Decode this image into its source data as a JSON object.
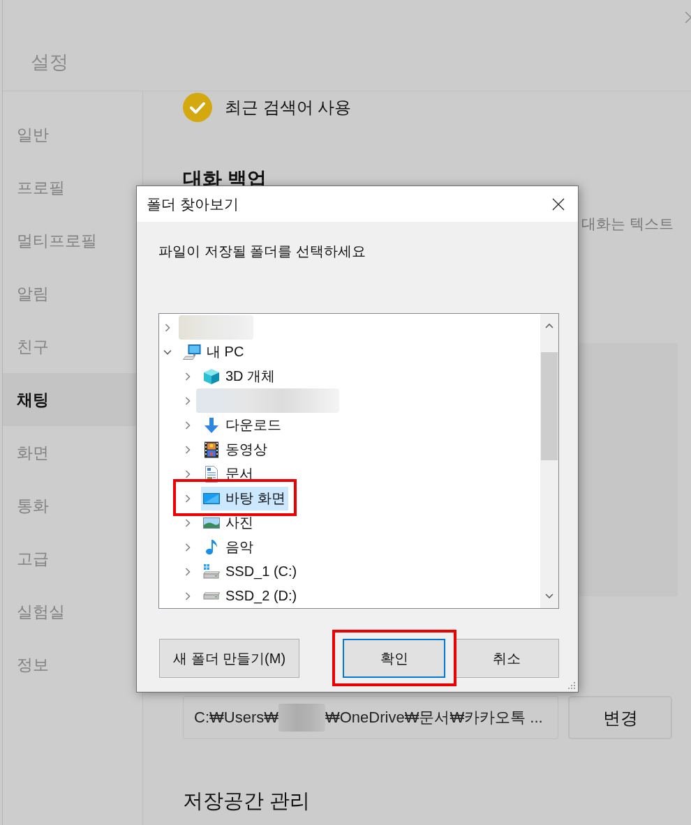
{
  "window": {
    "title": "설정"
  },
  "sidebar": {
    "items": [
      {
        "label": "일반",
        "selected": false
      },
      {
        "label": "프로필",
        "selected": false
      },
      {
        "label": "멀티프로필",
        "selected": false
      },
      {
        "label": "알림",
        "selected": false
      },
      {
        "label": "친구",
        "selected": false
      },
      {
        "label": "채팅",
        "selected": true
      },
      {
        "label": "화면",
        "selected": false
      },
      {
        "label": "통화",
        "selected": false
      },
      {
        "label": "고급",
        "selected": false
      },
      {
        "label": "실험실",
        "selected": false
      },
      {
        "label": "정보",
        "selected": false
      }
    ]
  },
  "content": {
    "recent_search": {
      "label": "최근 검색어 사용",
      "checked": true
    },
    "backup_heading": "대화 백업",
    "backup_description": "대화는 텍스트",
    "save_path": {
      "value_start": "C:₩Users₩",
      "redacted": true,
      "value_end": "₩OneDrive₩문서₩카카오톡 ..."
    },
    "change_button": "변경",
    "storage_heading": "저장공간 관리"
  },
  "dialog": {
    "title": "폴더 찾아보기",
    "instruction": "파일이 저장될 폴더를 선택하세요",
    "tree": [
      {
        "kind": "redacted",
        "expanded": false,
        "selected": false,
        "marked": false
      },
      {
        "kind": "computer",
        "label": "내 PC",
        "expanded": true,
        "selected": false,
        "marked": false,
        "children": [
          {
            "kind": "objects3d",
            "label": "3D 개체",
            "expanded": false,
            "selected": false,
            "marked": false
          },
          {
            "kind": "redacted",
            "expanded": false,
            "selected": false,
            "marked": false
          },
          {
            "kind": "downloads",
            "label": "다운로드",
            "expanded": false,
            "selected": false,
            "marked": false
          },
          {
            "kind": "videos",
            "label": "동영상",
            "expanded": false,
            "selected": false,
            "marked": false
          },
          {
            "kind": "documents",
            "label": "문서",
            "expanded": false,
            "selected": false,
            "marked": false
          },
          {
            "kind": "desktop",
            "label": "바탕 화면",
            "expanded": false,
            "selected": true,
            "marked": true
          },
          {
            "kind": "pictures",
            "label": "사진",
            "expanded": false,
            "selected": false,
            "marked": false
          },
          {
            "kind": "music",
            "label": "음악",
            "expanded": false,
            "selected": false,
            "marked": false
          },
          {
            "kind": "system_drive",
            "label": "SSD_1 (C:)",
            "expanded": false,
            "selected": false,
            "marked": false
          },
          {
            "kind": "drive",
            "label": "SSD_2 (D:)",
            "expanded": false,
            "selected": false,
            "marked": false
          }
        ]
      }
    ],
    "buttons": [
      {
        "label": "새 폴더 만들기(M)",
        "focused": false,
        "marked": false
      },
      {
        "label": "확인",
        "focused": true,
        "marked": true
      },
      {
        "label": "취소",
        "focused": false,
        "marked": false
      }
    ]
  }
}
